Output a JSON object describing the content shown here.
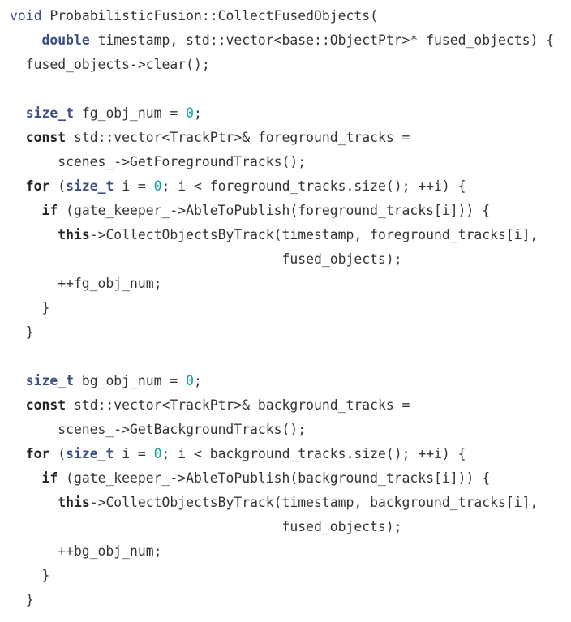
{
  "code_lines": [
    [
      [
        "vd",
        "void"
      ],
      [
        "p",
        " ProbabilisticFusion::CollectFusedObjects("
      ]
    ],
    [
      [
        "p",
        "    "
      ],
      [
        "ty",
        "double"
      ],
      [
        "p",
        " timestamp, std::vector<base::ObjectPtr>* fused_objects) {"
      ]
    ],
    [
      [
        "p",
        "  fused_objects->clear();"
      ]
    ],
    [
      [
        "p",
        ""
      ]
    ],
    [
      [
        "p",
        "  "
      ],
      [
        "ty",
        "size_t"
      ],
      [
        "p",
        " fg_obj_num = "
      ],
      [
        "num",
        "0"
      ],
      [
        "p",
        ";"
      ]
    ],
    [
      [
        "p",
        "  "
      ],
      [
        "kw",
        "const"
      ],
      [
        "p",
        " std::vector<TrackPtr>& foreground_tracks ="
      ]
    ],
    [
      [
        "p",
        "      scenes_->GetForegroundTracks();"
      ]
    ],
    [
      [
        "p",
        "  "
      ],
      [
        "kw",
        "for"
      ],
      [
        "p",
        " ("
      ],
      [
        "ty",
        "size_t"
      ],
      [
        "p",
        " i = "
      ],
      [
        "num",
        "0"
      ],
      [
        "p",
        "; i < foreground_tracks.size(); ++i) {"
      ]
    ],
    [
      [
        "p",
        "    "
      ],
      [
        "kw",
        "if"
      ],
      [
        "p",
        " (gate_keeper_->AbleToPublish(foreground_tracks[i])) {"
      ]
    ],
    [
      [
        "p",
        "      "
      ],
      [
        "kw",
        "this"
      ],
      [
        "p",
        "->CollectObjectsByTrack(timestamp, foreground_tracks[i],"
      ]
    ],
    [
      [
        "p",
        "                                  fused_objects);"
      ]
    ],
    [
      [
        "p",
        "      ++fg_obj_num;"
      ]
    ],
    [
      [
        "p",
        "    }"
      ]
    ],
    [
      [
        "p",
        "  }"
      ]
    ],
    [
      [
        "p",
        ""
      ]
    ],
    [
      [
        "p",
        "  "
      ],
      [
        "ty",
        "size_t"
      ],
      [
        "p",
        " bg_obj_num = "
      ],
      [
        "num",
        "0"
      ],
      [
        "p",
        ";"
      ]
    ],
    [
      [
        "p",
        "  "
      ],
      [
        "kw",
        "const"
      ],
      [
        "p",
        " std::vector<TrackPtr>& background_tracks ="
      ]
    ],
    [
      [
        "p",
        "      scenes_->GetBackgroundTracks();"
      ]
    ],
    [
      [
        "p",
        "  "
      ],
      [
        "kw",
        "for"
      ],
      [
        "p",
        " ("
      ],
      [
        "ty",
        "size_t"
      ],
      [
        "p",
        " i = "
      ],
      [
        "num",
        "0"
      ],
      [
        "p",
        "; i < background_tracks.size(); ++i) {"
      ]
    ],
    [
      [
        "p",
        "    "
      ],
      [
        "kw",
        "if"
      ],
      [
        "p",
        " (gate_keeper_->AbleToPublish(background_tracks[i])) {"
      ]
    ],
    [
      [
        "p",
        "      "
      ],
      [
        "kw",
        "this"
      ],
      [
        "p",
        "->CollectObjectsByTrack(timestamp, background_tracks[i],"
      ]
    ],
    [
      [
        "p",
        "                                  fused_objects);"
      ]
    ],
    [
      [
        "p",
        "      ++bg_obj_num;"
      ]
    ],
    [
      [
        "p",
        "    }"
      ]
    ],
    [
      [
        "p",
        "  }"
      ]
    ]
  ],
  "colors": {
    "keyword": "#222222",
    "type": "#3b5080",
    "number": "#14a0a0",
    "text": "#333333"
  }
}
